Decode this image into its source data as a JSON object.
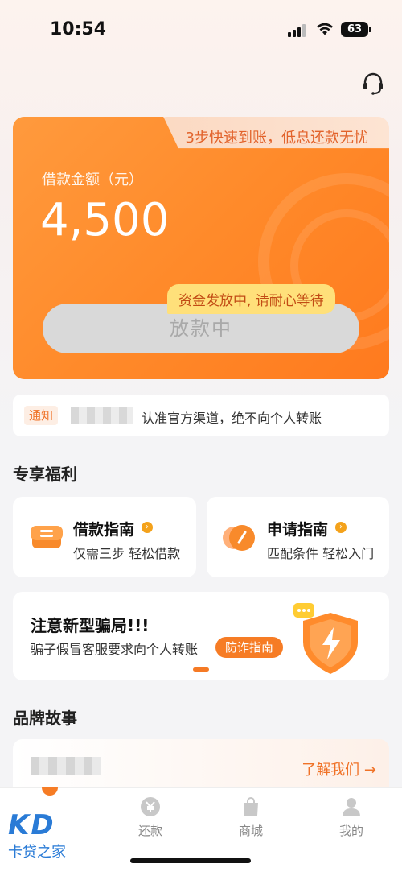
{
  "status_bar": {
    "time": "10:54",
    "battery": "63"
  },
  "loan_card": {
    "banner": "3步快速到账，低息还款无忧",
    "amount_label": "借款金额（元）",
    "amount": "4,500",
    "tooltip": "资金发放中, 请耐心等待",
    "button_label": "放款中"
  },
  "notice": {
    "tag": "通知",
    "text": "认准官方渠道，绝不向个人转账"
  },
  "welfare": {
    "title": "专享福利",
    "cards": [
      {
        "title": "借款指南",
        "desc": "仅需三步 轻松借款",
        "icon": "coin-stack-icon"
      },
      {
        "title": "申请指南",
        "desc": "匹配条件 轻松入门",
        "icon": "badge-icon"
      }
    ]
  },
  "fraud": {
    "title": "注意新型骗局!!!",
    "desc": "骗子假冒客服要求向个人转账",
    "button": "防诈指南"
  },
  "brand": {
    "title": "品牌故事",
    "link": "了解我们 →"
  },
  "tabs": [
    {
      "label": "还款",
      "icon": "yen-icon"
    },
    {
      "label": "商城",
      "icon": "shopping-bag-icon"
    },
    {
      "label": "我的",
      "icon": "user-icon"
    }
  ],
  "watermark": {
    "logo": "KD",
    "text": "卡贷之家"
  },
  "colors": {
    "accent": "#f67c25",
    "card": "#ff8a2a",
    "link": "#f07227"
  }
}
